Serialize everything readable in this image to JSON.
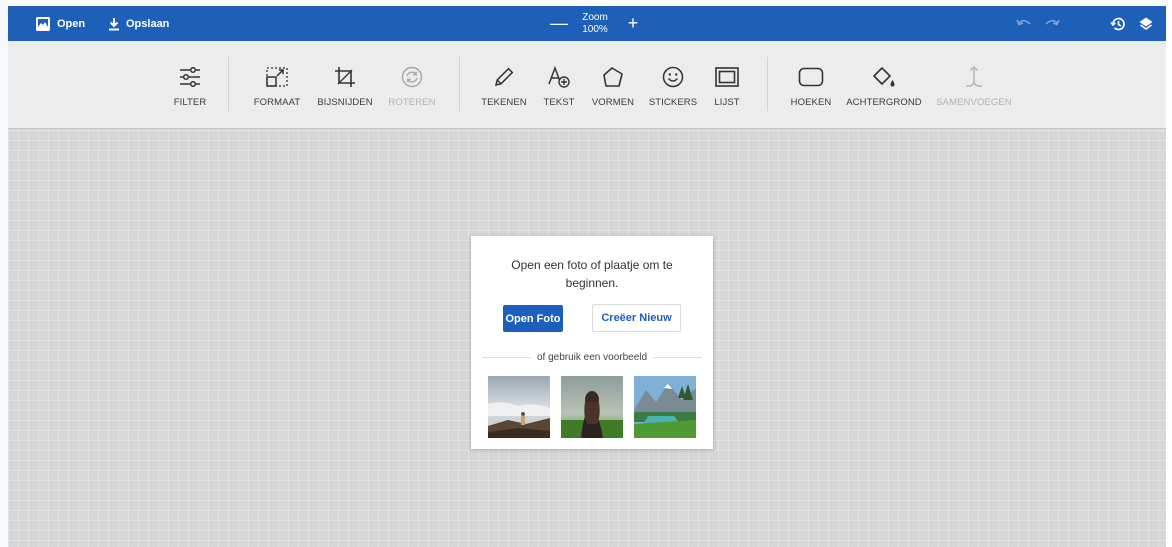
{
  "topbar": {
    "open_label": "Open",
    "save_label": "Opslaan",
    "zoom_label": "Zoom",
    "zoom_value": "100%",
    "zoom_out_symbol": "—",
    "zoom_in_symbol": "+",
    "icons": [
      "image-icon",
      "download-icon",
      "undo-icon",
      "redo-icon",
      "history-icon",
      "layers-icon"
    ]
  },
  "toolbar": {
    "filter": "FILTER",
    "formaat": "FORMAAT",
    "bijsnijden": "BIJSNIJDEN",
    "roteren": "ROTEREN",
    "tekenen": "TEKENEN",
    "tekst": "TEKST",
    "vormen": "VORMEN",
    "stickers": "STICKERS",
    "lijst": "LIJST",
    "hoeken": "HOEKEN",
    "achtergrond": "ACHTERGROND",
    "samenvoegen": "SAMENVOEGEN"
  },
  "dialog": {
    "message": "Open een foto of plaatje om te beginnen.",
    "open_photo": "Open Foto",
    "create_new": "Creëer Nieuw",
    "divider_text": "of gebruik een voorbeeld"
  },
  "colors": {
    "brand_blue": "#1e5fb8",
    "toolbar_bg": "#ececec",
    "canvas_bg": "#d7d7d7"
  }
}
